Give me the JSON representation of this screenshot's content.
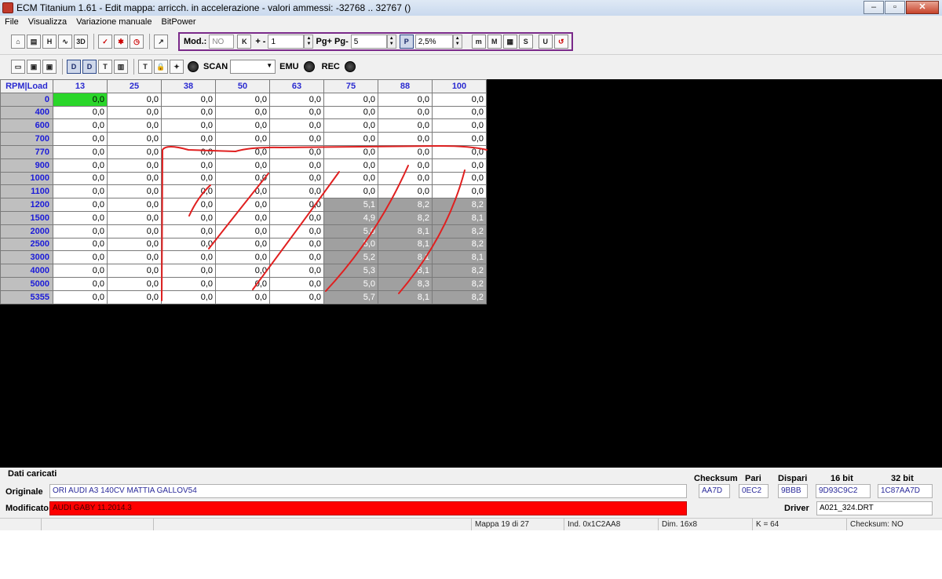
{
  "window": {
    "title": "ECM Titanium 1.61 - Edit mappa: arricch. in accelerazione - valori ammessi: -32768 .. 32767 ()"
  },
  "menu": [
    "File",
    "Visualizza",
    "Variazione manuale",
    "BitPower"
  ],
  "toolbar1": {
    "mod_label": "Mod.:",
    "mod_value": "NO",
    "k_label": "K",
    "plusminus_label": "+ -",
    "plusminus_value": "1",
    "pg_label": "Pg+ Pg-",
    "pg_value": "5",
    "p_label": "P",
    "percent_value": "2,5%"
  },
  "toolbar2": {
    "scan_label": "SCAN",
    "emu_label": "EMU",
    "rec_label": "REC"
  },
  "table": {
    "corner": "RPM|Load",
    "columns": [
      "13",
      "25",
      "38",
      "50",
      "63",
      "75",
      "88",
      "100"
    ],
    "rows": [
      {
        "rpm": "0",
        "v": [
          "0,0",
          "0,0",
          "0,0",
          "0,0",
          "0,0",
          "0,0",
          "0,0",
          "0,0"
        ]
      },
      {
        "rpm": "400",
        "v": [
          "0,0",
          "0,0",
          "0,0",
          "0,0",
          "0,0",
          "0,0",
          "0,0",
          "0,0"
        ]
      },
      {
        "rpm": "600",
        "v": [
          "0,0",
          "0,0",
          "0,0",
          "0,0",
          "0,0",
          "0,0",
          "0,0",
          "0,0"
        ]
      },
      {
        "rpm": "700",
        "v": [
          "0,0",
          "0,0",
          "0,0",
          "0,0",
          "0,0",
          "0,0",
          "0,0",
          "0,0"
        ]
      },
      {
        "rpm": "770",
        "v": [
          "0,0",
          "0,0",
          "0,0",
          "0,0",
          "0,0",
          "0,0",
          "0,0",
          "0,0"
        ]
      },
      {
        "rpm": "900",
        "v": [
          "0,0",
          "0,0",
          "0,0",
          "0,0",
          "0,0",
          "0,0",
          "0,0",
          "0,0"
        ]
      },
      {
        "rpm": "1000",
        "v": [
          "0,0",
          "0,0",
          "0,0",
          "0,0",
          "0,0",
          "0,0",
          "0,0",
          "0,0"
        ]
      },
      {
        "rpm": "1100",
        "v": [
          "0,0",
          "0,0",
          "0,0",
          "0,0",
          "0,0",
          "0,0",
          "0,0",
          "0,0"
        ]
      },
      {
        "rpm": "1200",
        "v": [
          "0,0",
          "0,0",
          "0,0",
          "0,0",
          "0,0",
          "5,1",
          "8,2",
          "8,2"
        ]
      },
      {
        "rpm": "1500",
        "v": [
          "0,0",
          "0,0",
          "0,0",
          "0,0",
          "0,0",
          "4,9",
          "8,2",
          "8,1"
        ]
      },
      {
        "rpm": "2000",
        "v": [
          "0,0",
          "0,0",
          "0,0",
          "0,0",
          "0,0",
          "5,0",
          "8,1",
          "8,2"
        ]
      },
      {
        "rpm": "2500",
        "v": [
          "0,0",
          "0,0",
          "0,0",
          "0,0",
          "0,0",
          "5,0",
          "8,1",
          "8,2"
        ]
      },
      {
        "rpm": "3000",
        "v": [
          "0,0",
          "0,0",
          "0,0",
          "0,0",
          "0,0",
          "5,2",
          "8,1",
          "8,1"
        ]
      },
      {
        "rpm": "4000",
        "v": [
          "0,0",
          "0,0",
          "0,0",
          "0,0",
          "0,0",
          "5,3",
          "8,1",
          "8,2"
        ]
      },
      {
        "rpm": "5000",
        "v": [
          "0,0",
          "0,0",
          "0,0",
          "0,0",
          "0,0",
          "5,0",
          "8,3",
          "8,2"
        ]
      },
      {
        "rpm": "5355",
        "v": [
          "0,0",
          "0,0",
          "0,0",
          "0,0",
          "0,0",
          "5,7",
          "8,1",
          "8,2"
        ]
      }
    ]
  },
  "info": {
    "header": "Dati caricati",
    "originale_label": "Originale",
    "originale_value": "ORI AUDI A3 140CV MATTIA GALLOV54",
    "modificato_label": "Modificato",
    "modificato_value": "AUDI GABY 11.2014.3",
    "checksum_label": "Checksum",
    "checksum_value": "AA7D",
    "pari_label": "Pari",
    "pari_value": "0EC2",
    "dispari_label": "Dispari",
    "dispari_value": "9BBB",
    "bit16_label": "16 bit",
    "bit16_value": "9D93C9C2",
    "bit32_label": "32 bit",
    "bit32_value": "1C87AA7D",
    "driver_label": "Driver",
    "driver_value": "A021_324.DRT"
  },
  "status": {
    "mappa": "Mappa 19 di 27",
    "ind": "Ind. 0x1C2AA8",
    "dim": "Dim. 16x8",
    "k": "K = 64",
    "checksum": "Checksum: NO"
  },
  "colors": {
    "selected_cell": "#2ad62a",
    "modified_cell": "#a0a0a0",
    "modificato_field": "#ff0000",
    "toolbar_border": "#7a2a8a"
  }
}
